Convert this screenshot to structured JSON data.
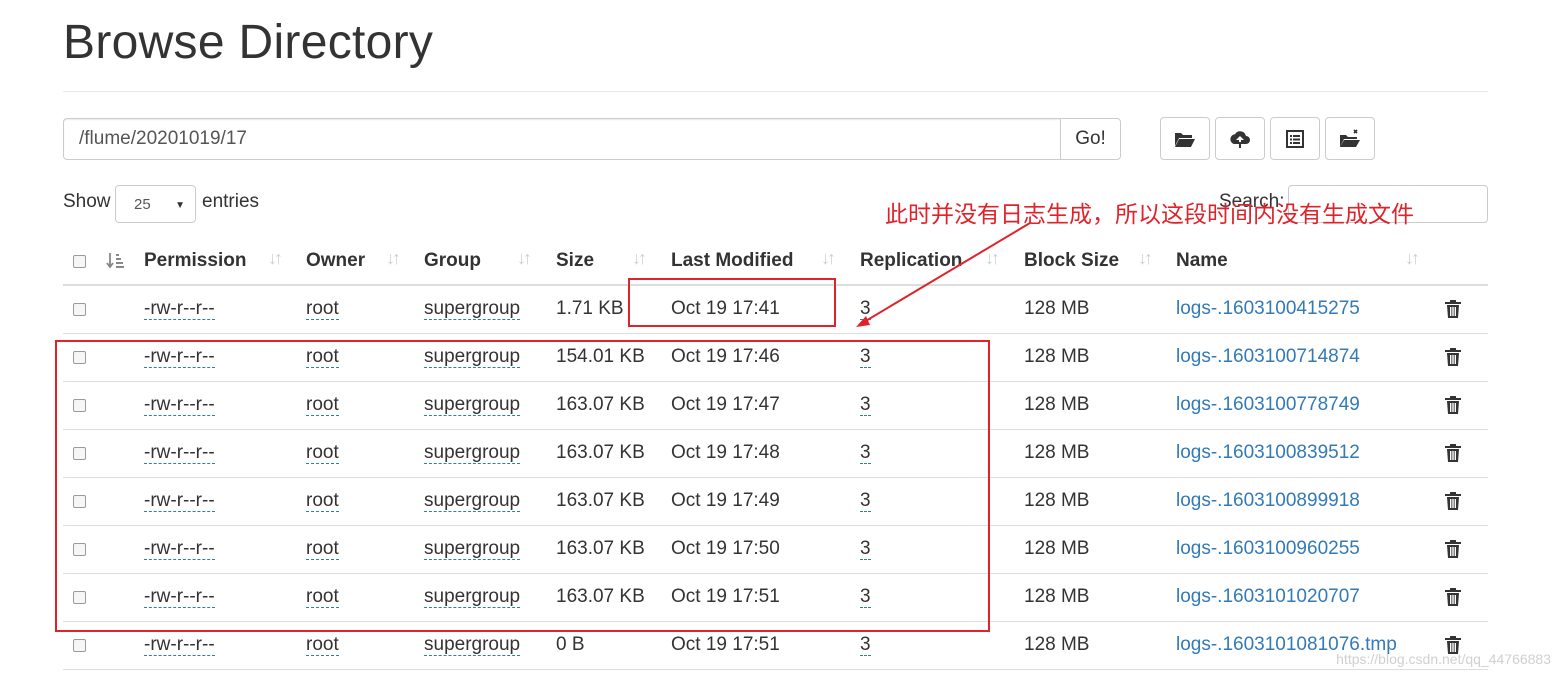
{
  "page": {
    "title": "Browse Directory"
  },
  "toolbar": {
    "path_value": "/flume/20201019/17",
    "go_label": "Go!",
    "buttons": [
      "folder-open-icon",
      "cloud-upload-icon",
      "list-alt-icon",
      "cut-folder-icon"
    ]
  },
  "table_controls": {
    "show_label": "Show",
    "page_size": "25",
    "entries_label": "entries",
    "search_label": "Search:"
  },
  "columns": [
    "Permission",
    "Owner",
    "Group",
    "Size",
    "Last Modified",
    "Replication",
    "Block Size",
    "Name"
  ],
  "rows": [
    {
      "permission": "-rw-r--r--",
      "owner": "root",
      "group": "supergroup",
      "size": "1.71 KB",
      "modified": "Oct 19 17:41",
      "replication": "3",
      "block_size": "128 MB",
      "name": "logs-.1603100415275"
    },
    {
      "permission": "-rw-r--r--",
      "owner": "root",
      "group": "supergroup",
      "size": "154.01 KB",
      "modified": "Oct 19 17:46",
      "replication": "3",
      "block_size": "128 MB",
      "name": "logs-.1603100714874"
    },
    {
      "permission": "-rw-r--r--",
      "owner": "root",
      "group": "supergroup",
      "size": "163.07 KB",
      "modified": "Oct 19 17:47",
      "replication": "3",
      "block_size": "128 MB",
      "name": "logs-.1603100778749"
    },
    {
      "permission": "-rw-r--r--",
      "owner": "root",
      "group": "supergroup",
      "size": "163.07 KB",
      "modified": "Oct 19 17:48",
      "replication": "3",
      "block_size": "128 MB",
      "name": "logs-.1603100839512"
    },
    {
      "permission": "-rw-r--r--",
      "owner": "root",
      "group": "supergroup",
      "size": "163.07 KB",
      "modified": "Oct 19 17:49",
      "replication": "3",
      "block_size": "128 MB",
      "name": "logs-.1603100899918"
    },
    {
      "permission": "-rw-r--r--",
      "owner": "root",
      "group": "supergroup",
      "size": "163.07 KB",
      "modified": "Oct 19 17:50",
      "replication": "3",
      "block_size": "128 MB",
      "name": "logs-.1603100960255"
    },
    {
      "permission": "-rw-r--r--",
      "owner": "root",
      "group": "supergroup",
      "size": "163.07 KB",
      "modified": "Oct 19 17:51",
      "replication": "3",
      "block_size": "128 MB",
      "name": "logs-.1603101020707"
    },
    {
      "permission": "-rw-r--r--",
      "owner": "root",
      "group": "supergroup",
      "size": "0 B",
      "modified": "Oct 19 17:51",
      "replication": "3",
      "block_size": "128 MB",
      "name": "logs-.1603101081076.tmp"
    }
  ],
  "annotation": {
    "text": "此时并没有日志生成，所以这段时间内没有生成文件",
    "color": "#e0232a"
  },
  "colors": {
    "link": "#337ab7",
    "border": "#dddddd",
    "text": "#333333"
  },
  "watermark": "https://blog.csdn.net/qq_44766883"
}
